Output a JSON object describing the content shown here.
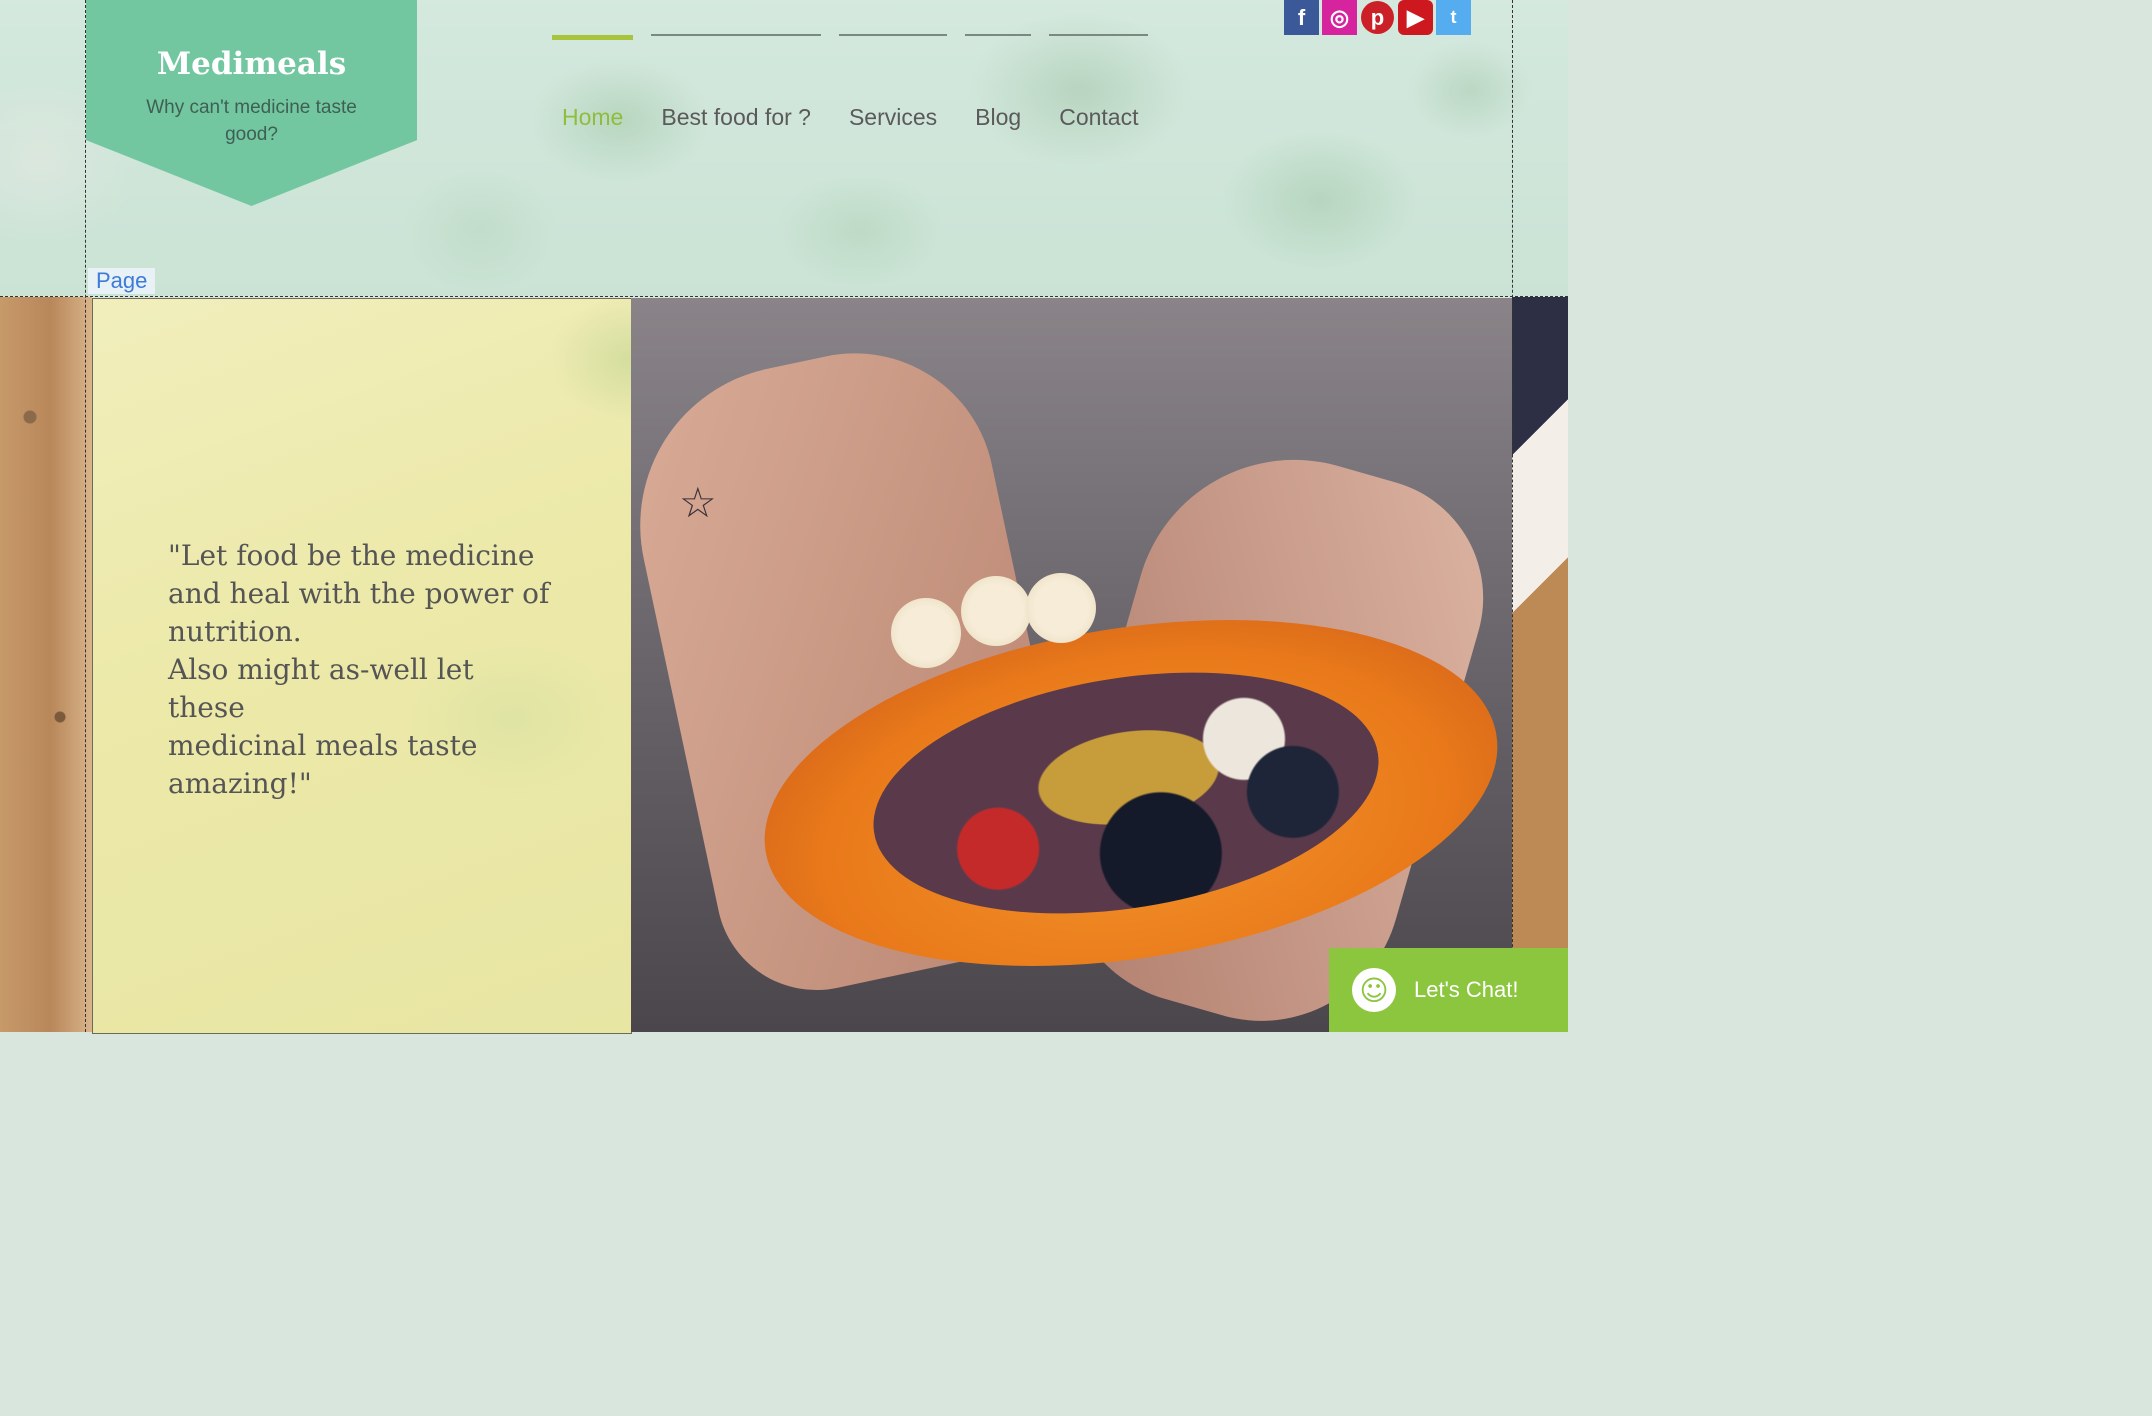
{
  "site": {
    "title": "Medimeals",
    "tagline": "Why can't medicine taste good?"
  },
  "nav": {
    "items": [
      {
        "label": "Home",
        "active": true
      },
      {
        "label": "Best food for ?",
        "active": false
      },
      {
        "label": "Services",
        "active": false
      },
      {
        "label": "Blog",
        "active": false
      },
      {
        "label": "Contact",
        "active": false
      }
    ],
    "active_color": "#8fbd3e"
  },
  "social": [
    {
      "name": "facebook-icon",
      "glyph": "f"
    },
    {
      "name": "instagram-icon",
      "glyph": "◎"
    },
    {
      "name": "pinterest-icon",
      "glyph": "p"
    },
    {
      "name": "youtube-icon",
      "glyph": "▶"
    },
    {
      "name": "twitter-icon",
      "glyph": "t"
    }
  ],
  "editor": {
    "section_tag": "Page"
  },
  "hero": {
    "quote": "\"Let food be the medicine and heal with the power of nutrition.\n Also might as-well let these\nmedicinal meals taste amazing!\""
  },
  "chat": {
    "label": "Let's Chat!",
    "icon": "smiley-icon",
    "color": "#8cc63f"
  },
  "colors": {
    "logo_banner": "#72c7a0",
    "quote_panel": "#ece9a9"
  }
}
